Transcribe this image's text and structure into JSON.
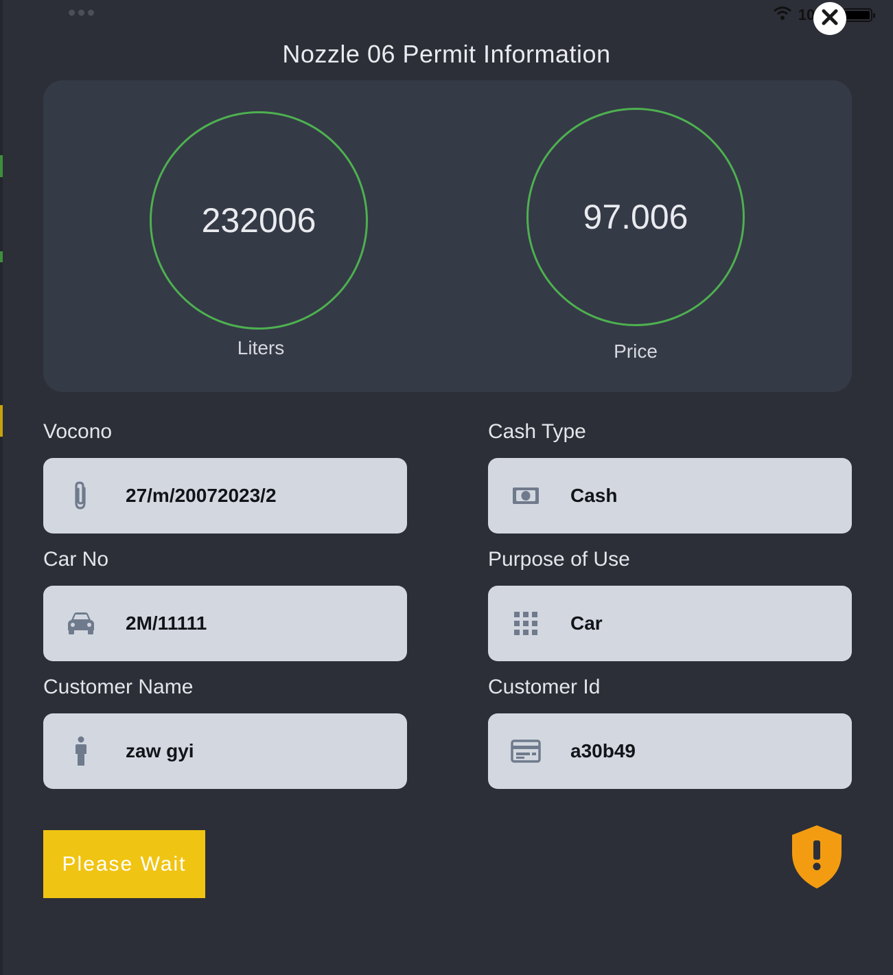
{
  "status_bar": {
    "battery_percent": "100%",
    "battery_level": 1.0
  },
  "header": {
    "title": "Nozzle 06 Permit Information"
  },
  "stats": {
    "liters": {
      "value": "232006",
      "label": "Liters"
    },
    "price": {
      "value": "97.006",
      "label": "Price"
    }
  },
  "fields": {
    "vocono": {
      "label": "Vocono",
      "value": "27/m/20072023/2",
      "icon": "paperclip-icon"
    },
    "cash_type": {
      "label": "Cash Type",
      "value": "Cash",
      "icon": "cash-icon"
    },
    "car_no": {
      "label": "Car No",
      "value": "2M/11111",
      "icon": "car-icon"
    },
    "purpose": {
      "label": "Purpose of Use",
      "value": "Car",
      "icon": "grid-icon"
    },
    "customer_name": {
      "label": "Customer Name",
      "value": "zaw gyi",
      "icon": "person-icon"
    },
    "customer_id": {
      "label": "Customer Id",
      "value": "a30b49",
      "icon": "id-card-icon"
    }
  },
  "actions": {
    "wait_label": "Please Wait"
  },
  "colors": {
    "background": "#2c2f37",
    "panel": "#353a47",
    "ring": "#4db14f",
    "field_bg": "#d3d8e0",
    "icon": "#6f7a8c",
    "button": "#f0c413",
    "warning": "#f39c12"
  }
}
